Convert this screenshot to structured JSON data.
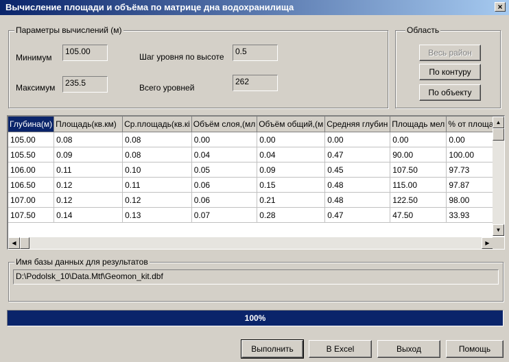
{
  "window": {
    "title": "Вычисление площади и объёма по матрице дна водохранилища",
    "close": "×"
  },
  "params": {
    "legend": "Параметры вычислений (м)",
    "min_label": "Минимум",
    "min_value": "105.00",
    "max_label": "Максимум",
    "max_value": "235.5",
    "step_label": "Шаг уровня по высоте",
    "step_value": "0.5",
    "levels_label": "Всего уровней",
    "levels_value": "262"
  },
  "area": {
    "legend": "Область",
    "all_region": "Весь район",
    "by_contour": "По контуру",
    "by_object": "По объекту"
  },
  "table": {
    "headers": [
      "Глубина(м)",
      "Площадь(кв.км)",
      "Ср.площадь(кв.кі",
      "Объём слоя,(мл",
      "Объём общий,(м",
      "Средняя глубин",
      "Площадь мел",
      "% от площа"
    ],
    "rows": [
      [
        "105.00",
        "0.08",
        "0.08",
        "0.00",
        "0.00",
        "0.00",
        "0.00",
        "0.00"
      ],
      [
        "105.50",
        "0.09",
        "0.08",
        "0.04",
        "0.04",
        "0.47",
        "90.00",
        "100.00"
      ],
      [
        "106.00",
        "0.11",
        "0.10",
        "0.05",
        "0.09",
        "0.45",
        "107.50",
        "97.73"
      ],
      [
        "106.50",
        "0.12",
        "0.11",
        "0.06",
        "0.15",
        "0.48",
        "115.00",
        "97.87"
      ],
      [
        "107.00",
        "0.12",
        "0.12",
        "0.06",
        "0.21",
        "0.48",
        "122.50",
        "98.00"
      ],
      [
        "107.50",
        "0.14",
        "0.13",
        "0.07",
        "0.28",
        "0.47",
        "47.50",
        "33.93"
      ]
    ]
  },
  "db": {
    "legend": "Имя базы данных для результатов",
    "path": "D:\\Podolsk_10\\Data.Mtf\\Geomon_kit.dbf"
  },
  "progress": {
    "label": "100%",
    "fraction": 1.0
  },
  "buttons": {
    "run": "Выполнить",
    "excel": "В Excel",
    "exit": "Выход",
    "help": "Помощь"
  },
  "colors": {
    "titlebar": "#0a246a",
    "selection": "#0a246a",
    "face": "#d4d0c8"
  }
}
